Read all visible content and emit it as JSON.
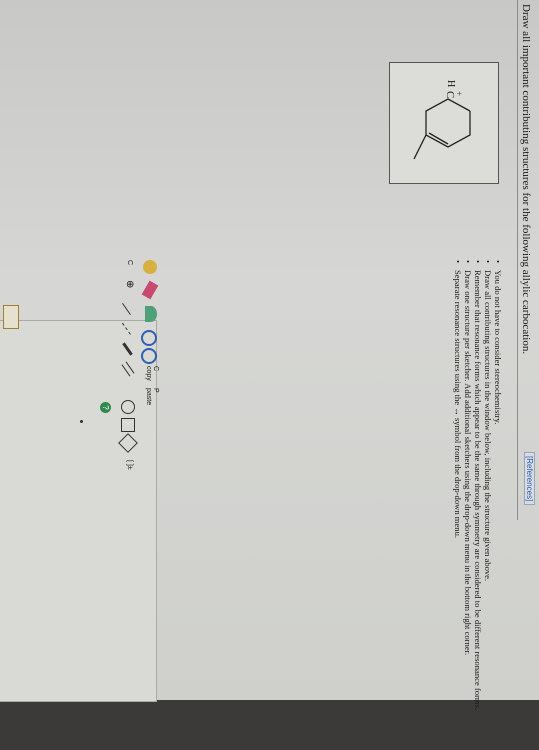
{
  "header": {
    "references_label": "[References]",
    "prompt": "Draw all important contributing structures for the following allylic carbocation."
  },
  "molecule": {
    "charge_label": "+",
    "atom_C": "C",
    "atom_H": "H"
  },
  "instructions": [
    "You do not have to consider stereochemistry.",
    "Draw all contributing structures in the window below, including the structure given above.",
    "Remember that resonance forms which appear to be the same through symmetry are considered to be different resonance forms.",
    "Draw one structure per sketcher. Add additional sketchers using the drop-down menu in the bottom right corner.",
    "Separate resonance structures using the ↔ symbol from the drop-down menu."
  ],
  "toolbar": {
    "copy_label": "C",
    "copy_sub": "copy",
    "paste_label": "P",
    "paste_sub": "paste",
    "charge_plus": "⊕",
    "carbon_label": "C",
    "bracket_label": "[ ]±",
    "help_label": "?"
  }
}
